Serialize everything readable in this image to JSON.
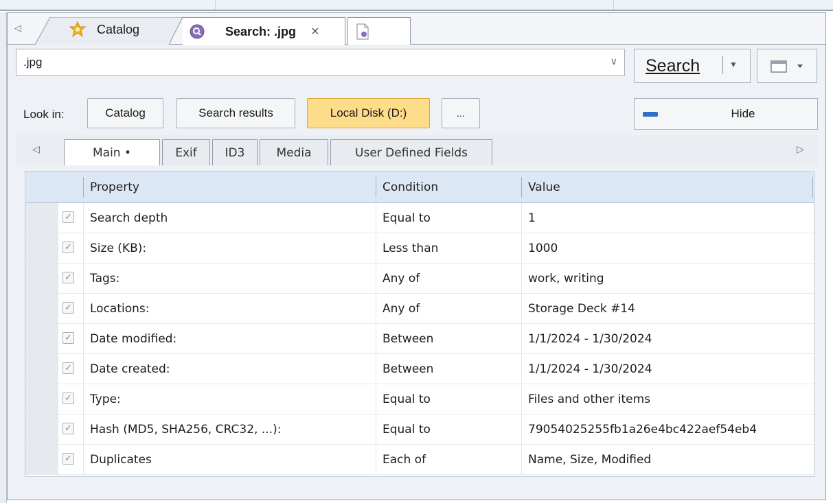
{
  "document_tabs": {
    "catalog_label": "Catalog",
    "search_label": "Search: .jpg",
    "close_glyph": "×",
    "left_arrow": "◁"
  },
  "search": {
    "query": ".jpg",
    "search_button_label": "Search",
    "hide_button_label": "Hide"
  },
  "look_in": {
    "label": "Look in:",
    "buttons": [
      "Catalog",
      "Search results",
      "Local Disk (D:)",
      "..."
    ],
    "selected": "Local Disk (D:)"
  },
  "criteria_tabs": {
    "tabs": [
      "Main •",
      "Exif",
      "ID3",
      "Media",
      "User Defined Fields"
    ],
    "active": "Main •",
    "left_arrow": "◁",
    "right_arrow": "▷"
  },
  "grid": {
    "columns": [
      "Property",
      "Condition",
      "Value"
    ],
    "rows": [
      {
        "property": "Search depth",
        "condition": "Equal to",
        "value": "1",
        "checked": true
      },
      {
        "property": "Size (KB):",
        "condition": "Less than",
        "value": "1000",
        "checked": true
      },
      {
        "property": "Tags:",
        "condition": "Any of",
        "value": "work, writing",
        "checked": true
      },
      {
        "property": "Locations:",
        "condition": "Any of",
        "value": "Storage Deck #14",
        "checked": true
      },
      {
        "property": "Date modified:",
        "condition": "Between",
        "value": "1/1/2024 - 1/30/2024",
        "checked": true
      },
      {
        "property": "Date created:",
        "condition": "Between",
        "value": "1/1/2024 - 1/30/2024",
        "checked": true
      },
      {
        "property": "Type:",
        "condition": "Equal to",
        "value": "Files and other items",
        "checked": true
      },
      {
        "property": "Hash (MD5, SHA256, CRC32, ...):",
        "condition": "Equal to",
        "value": "79054025255fb1a26e4bc422aef54eb4",
        "checked": true
      },
      {
        "property": "Duplicates",
        "condition": "Each of",
        "value": "Name, Size, Modified",
        "checked": true
      }
    ]
  },
  "colors": {
    "selected_location": "#fddc8a",
    "grid_header": "#dce7f5",
    "hide_icon": "#2f6fc7"
  }
}
